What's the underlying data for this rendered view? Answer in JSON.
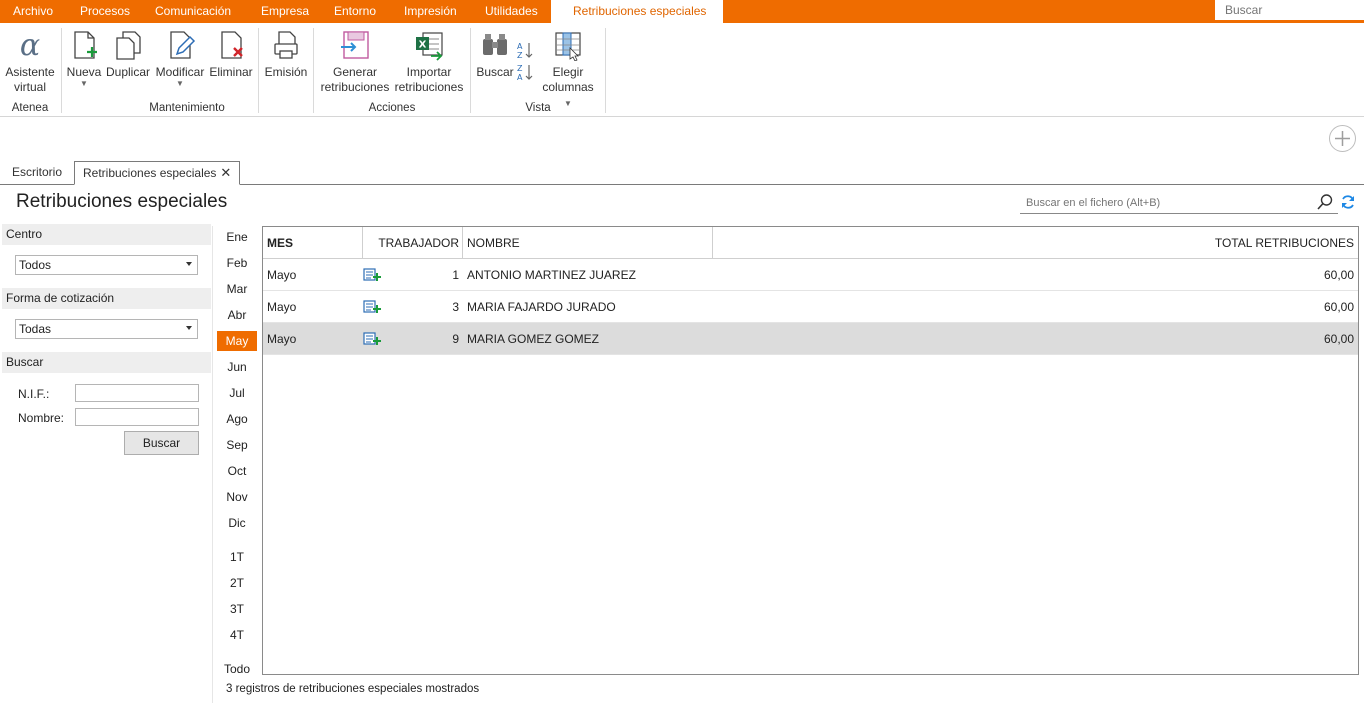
{
  "menu": {
    "items": [
      "Archivo",
      "Procesos",
      "Comunicación",
      "Empresa",
      "Entorno",
      "Impresión",
      "Utilidades",
      "Retribuciones especiales"
    ],
    "search_placeholder": "Buscar"
  },
  "ribbon": {
    "asistente": "Asistente virtual",
    "nueva": "Nueva",
    "duplicar": "Duplicar",
    "modificar": "Modificar",
    "eliminar": "Eliminar",
    "emision": "Emisión",
    "generar": "Generar retribuciones",
    "importar": "Importar retribuciones",
    "buscar": "Buscar",
    "elegir": "Elegir columnas",
    "groups": {
      "atenea": "Atenea",
      "mantenimiento": "Mantenimiento",
      "acciones": "Acciones",
      "vista": "Vista"
    }
  },
  "tabs": {
    "escritorio": "Escritorio",
    "retribuciones": "Retribuciones especiales"
  },
  "page": {
    "title": "Retribuciones especiales",
    "search_placeholder": "Buscar en el fichero (Alt+B)"
  },
  "filters": {
    "centro_label": "Centro",
    "centro_value": "Todos",
    "forma_label": "Forma de cotización",
    "forma_value": "Todas",
    "buscar_label": "Buscar",
    "nif_label": "N.I.F.:",
    "nombre_label": "Nombre:",
    "buscar_button": "Buscar"
  },
  "months": [
    "Ene",
    "Feb",
    "Mar",
    "Abr",
    "May",
    "Jun",
    "Jul",
    "Ago",
    "Sep",
    "Oct",
    "Nov",
    "Dic"
  ],
  "quarters": [
    "1T",
    "2T",
    "3T",
    "4T"
  ],
  "all_label": "Todo",
  "selected_month": "May",
  "grid": {
    "headers": {
      "mes": "MES",
      "trabajador": "TRABAJADOR",
      "nombre": "NOMBRE",
      "total": "TOTAL RETRIBUCIONES"
    },
    "rows": [
      {
        "mes": "Mayo",
        "trabajador": "1",
        "nombre": "ANTONIO MARTINEZ JUAREZ",
        "total": "60,00"
      },
      {
        "mes": "Mayo",
        "trabajador": "3",
        "nombre": "MARIA FAJARDO JURADO",
        "total": "60,00"
      },
      {
        "mes": "Mayo",
        "trabajador": "9",
        "nombre": "MARIA GOMEZ GOMEZ",
        "total": "60,00"
      }
    ]
  },
  "status": "3 registros de retribuciones especiales mostrados",
  "colors": {
    "accent": "#ef6c00",
    "selected_row": "#dcdcdc"
  }
}
